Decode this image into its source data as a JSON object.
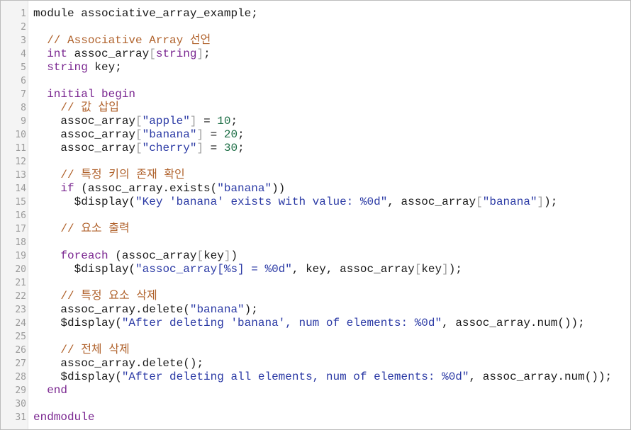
{
  "editor": {
    "language": "SystemVerilog",
    "colors": {
      "keyword": "#7a2690",
      "comment": "#b0622c",
      "string": "#2b3aa5",
      "number": "#1b6d44",
      "punctuation": "#9d9d9d",
      "text": "#1a1a1a"
    },
    "lines": [
      [
        [
          "t",
          "module associative_array_example;"
        ]
      ],
      [],
      [
        [
          "t",
          "  "
        ],
        [
          "cmt",
          "// Associative Array 선언"
        ]
      ],
      [
        [
          "t",
          "  "
        ],
        [
          "type",
          "int"
        ],
        [
          "t",
          " assoc_array"
        ],
        [
          "pn",
          "["
        ],
        [
          "type",
          "string"
        ],
        [
          "pn",
          "]"
        ],
        [
          "t",
          ";"
        ]
      ],
      [
        [
          "t",
          "  "
        ],
        [
          "type",
          "string"
        ],
        [
          "t",
          " key;"
        ]
      ],
      [],
      [
        [
          "t",
          "  "
        ],
        [
          "kw",
          "initial begin"
        ]
      ],
      [
        [
          "t",
          "    "
        ],
        [
          "cmt",
          "// 값 삽입"
        ]
      ],
      [
        [
          "t",
          "    assoc_array"
        ],
        [
          "pn",
          "["
        ],
        [
          "str",
          "\"apple\""
        ],
        [
          "pn",
          "]"
        ],
        [
          "t",
          " = "
        ],
        [
          "num",
          "10"
        ],
        [
          "t",
          ";"
        ]
      ],
      [
        [
          "t",
          "    assoc_array"
        ],
        [
          "pn",
          "["
        ],
        [
          "str",
          "\"banana\""
        ],
        [
          "pn",
          "]"
        ],
        [
          "t",
          " = "
        ],
        [
          "num",
          "20"
        ],
        [
          "t",
          ";"
        ]
      ],
      [
        [
          "t",
          "    assoc_array"
        ],
        [
          "pn",
          "["
        ],
        [
          "str",
          "\"cherry\""
        ],
        [
          "pn",
          "]"
        ],
        [
          "t",
          " = "
        ],
        [
          "num",
          "30"
        ],
        [
          "t",
          ";"
        ]
      ],
      [],
      [
        [
          "t",
          "    "
        ],
        [
          "cmt",
          "// 특정 키의 존재 확인"
        ]
      ],
      [
        [
          "t",
          "    "
        ],
        [
          "kw",
          "if"
        ],
        [
          "t",
          " (assoc_array.exists("
        ],
        [
          "str",
          "\"banana\""
        ],
        [
          "t",
          "))"
        ]
      ],
      [
        [
          "t",
          "      $display("
        ],
        [
          "str",
          "\"Key 'banana' exists with value: %0d\""
        ],
        [
          "t",
          ", assoc_array"
        ],
        [
          "pn",
          "["
        ],
        [
          "str",
          "\"banana\""
        ],
        [
          "pn",
          "]"
        ],
        [
          "t",
          ");"
        ]
      ],
      [],
      [
        [
          "t",
          "    "
        ],
        [
          "cmt",
          "// 요소 출력"
        ]
      ],
      [],
      [
        [
          "t",
          "    "
        ],
        [
          "kw",
          "foreach"
        ],
        [
          "t",
          " (assoc_array"
        ],
        [
          "pn",
          "["
        ],
        [
          "t",
          "key"
        ],
        [
          "pn",
          "]"
        ],
        [
          "t",
          ")"
        ]
      ],
      [
        [
          "t",
          "      $display("
        ],
        [
          "str",
          "\"assoc_array[%s] = %0d\""
        ],
        [
          "t",
          ", key, assoc_array"
        ],
        [
          "pn",
          "["
        ],
        [
          "t",
          "key"
        ],
        [
          "pn",
          "]"
        ],
        [
          "t",
          ");"
        ]
      ],
      [],
      [
        [
          "t",
          "    "
        ],
        [
          "cmt",
          "// 특정 요소 삭제"
        ]
      ],
      [
        [
          "t",
          "    assoc_array.delete("
        ],
        [
          "str",
          "\"banana\""
        ],
        [
          "t",
          ");"
        ]
      ],
      [
        [
          "t",
          "    $display("
        ],
        [
          "str",
          "\"After deleting 'banana', num of elements: %0d\""
        ],
        [
          "t",
          ", assoc_array.num());"
        ]
      ],
      [],
      [
        [
          "t",
          "    "
        ],
        [
          "cmt",
          "// 전체 삭제"
        ]
      ],
      [
        [
          "t",
          "    assoc_array.delete();"
        ]
      ],
      [
        [
          "t",
          "    $display("
        ],
        [
          "str",
          "\"After deleting all elements, num of elements: %0d\""
        ],
        [
          "t",
          ", assoc_array.num());"
        ]
      ],
      [
        [
          "t",
          "  "
        ],
        [
          "kw",
          "end"
        ]
      ],
      [],
      [
        [
          "kw",
          "endmodule"
        ]
      ]
    ]
  }
}
